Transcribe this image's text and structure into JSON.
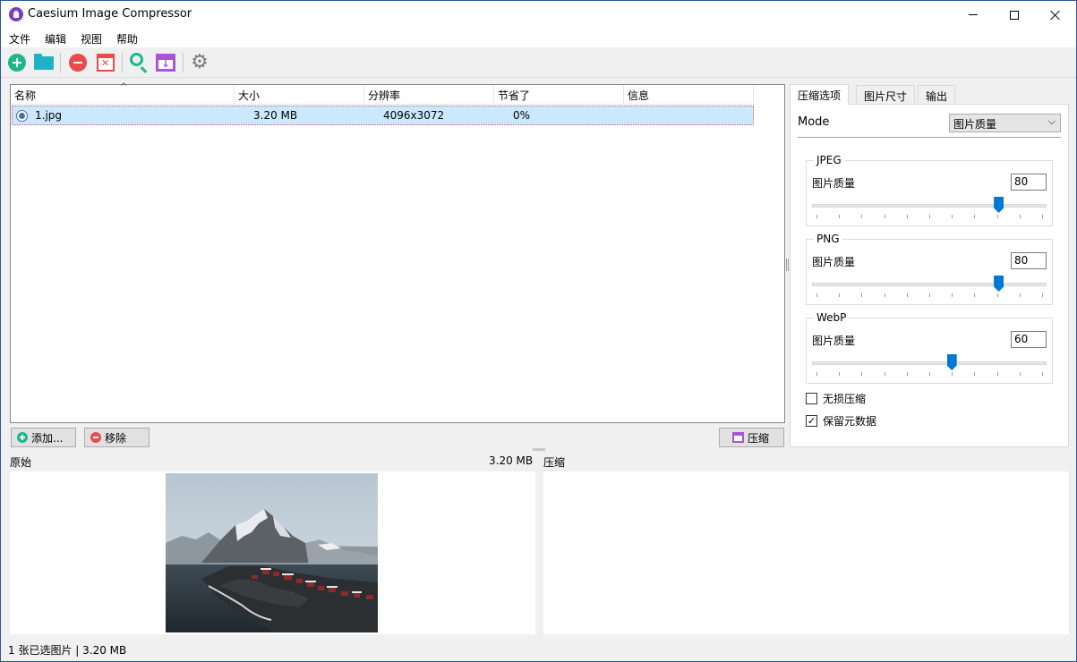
{
  "window": {
    "title": "Caesium Image Compressor"
  },
  "menu": [
    "文件",
    "编辑",
    "视图",
    "帮助"
  ],
  "toolbar": {
    "icons": [
      "add-icon",
      "open-folder-icon",
      "remove-icon",
      "clear-list-icon",
      "preview-icon",
      "compress-icon",
      "settings-icon"
    ]
  },
  "file_list": {
    "columns": [
      "名称",
      "大小",
      "分辨率",
      "节省了",
      "信息"
    ],
    "rows": [
      {
        "name": "1.jpg",
        "size": "3.20 MB",
        "resolution": "4096x3072",
        "saved": "0%",
        "info": ""
      }
    ]
  },
  "buttons": {
    "add": "添加...",
    "remove": "移除",
    "compress": "压缩"
  },
  "tabs": [
    "压缩选项",
    "图片尺寸",
    "输出"
  ],
  "compression": {
    "mode_label": "Mode",
    "mode_value": "图片质量",
    "groups": [
      {
        "title": "JPEG",
        "label": "图片质量",
        "value": "80",
        "level": 80
      },
      {
        "title": "PNG",
        "label": "图片质量",
        "value": "80",
        "level": 80
      },
      {
        "title": "WebP",
        "label": "图片质量",
        "value": "60",
        "level": 60
      }
    ],
    "lossless": {
      "label": "无损压缩",
      "checked": false
    },
    "keep_metadata": {
      "label": "保留元数据",
      "checked": true
    }
  },
  "preview": {
    "original_label": "原始",
    "original_size": "3.20 MB",
    "compressed_label": "压缩"
  },
  "status": "1 张已选图片 | 3.20 MB",
  "colors": {
    "accent": "#0078d7",
    "selection": "#cce8ff",
    "green": "#1fb78a",
    "red": "#e84b4b",
    "purple": "#a855d6"
  }
}
